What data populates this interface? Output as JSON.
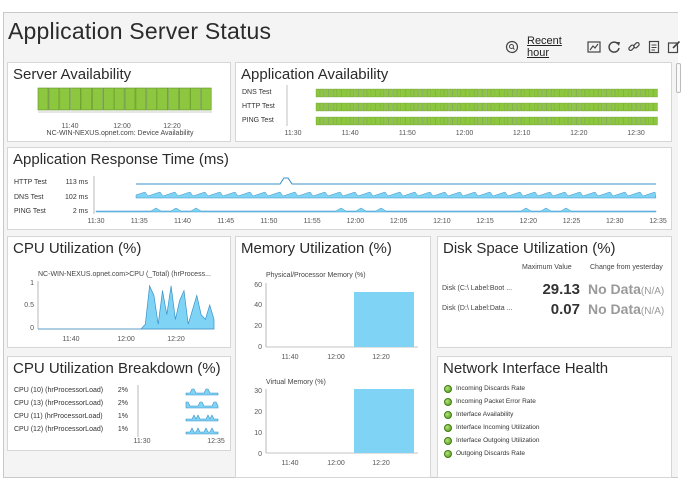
{
  "page": {
    "title": "Application Server Status"
  },
  "toolbar": {
    "range_label": "Recent hour",
    "icons": [
      "search-icon",
      "chart-icon",
      "refresh-icon",
      "link-icon",
      "report-icon",
      "edit-icon"
    ]
  },
  "server_availability": {
    "title": "Server Availability",
    "ticks": [
      "11:40",
      "12:00",
      "12:20"
    ],
    "caption": "NC-WIN-NEXUS.opnet.com: Device Availability",
    "color": "#8dc63f"
  },
  "application_availability": {
    "title": "Application Availability",
    "rows": [
      "DNS Test",
      "HTTP Test",
      "PING Test"
    ],
    "ticks": [
      "11:30",
      "11:40",
      "11:50",
      "12:00",
      "12:10",
      "12:20",
      "12:30"
    ]
  },
  "response_time": {
    "title": "Application Response Time (ms)",
    "rows": [
      {
        "label": "HTTP Test",
        "value": "113 ms"
      },
      {
        "label": "DNS Test",
        "value": "102 ms"
      },
      {
        "label": "PING Test",
        "value": "2 ms"
      }
    ],
    "ticks": [
      "11:30",
      "11:35",
      "11:40",
      "11:45",
      "11:50",
      "11:55",
      "12:00",
      "12:05",
      "12:10",
      "12:15",
      "12:20",
      "12:25",
      "12:30",
      "12:35"
    ]
  },
  "cpu": {
    "title": "CPU Utilization (%)",
    "chart_title": "NC-WIN-NEXUS.opnet.com>CPU (_Total) (hrProcess...",
    "y_ticks": [
      "1",
      "0.5",
      "0"
    ],
    "x_ticks": [
      "11:40",
      "12:00",
      "12:20"
    ]
  },
  "cpu_breakdown": {
    "title": "CPU Utilization Breakdown (%)",
    "rows": [
      {
        "label": "CPU (10) (hrProcessorLoad)",
        "value": "2%"
      },
      {
        "label": "CPU (13) (hrProcessorLoad)",
        "value": "2%"
      },
      {
        "label": "CPU (11) (hrProcessorLoad)",
        "value": "1%"
      },
      {
        "label": "CPU (12) (hrProcessorLoad)",
        "value": "1%"
      }
    ],
    "x_ticks": [
      "11:30",
      "12:35"
    ]
  },
  "memory": {
    "title": "Memory Utilization (%)",
    "chart1_title": "Physical/Processor Memory (%)",
    "chart1_y": [
      "60",
      "40",
      "20",
      "0"
    ],
    "chart2_title": "Virtual Memory (%)",
    "chart2_y": [
      "30",
      "20",
      "10",
      "0"
    ],
    "x_ticks": [
      "11:40",
      "12:00",
      "12:20"
    ],
    "bar_color": "#7fd3f4"
  },
  "disk": {
    "title": "Disk Space Utilization (%)",
    "col_max": "Maximum Value",
    "col_change": "Change from yesterday",
    "rows": [
      {
        "label": "Disk (C:\\ Label:Boot ...",
        "value": "29.13",
        "change": "No Data",
        "change_suffix": "(N/A)"
      },
      {
        "label": "Disk (D:\\ Label:Data ...",
        "value": "0.07",
        "change": "No Data",
        "change_suffix": "(N/A)"
      }
    ]
  },
  "network": {
    "title": "Network Interface Health",
    "items": [
      "Incoming Discards Rate",
      "Incoming Packet Error Rate",
      "Interface Availability",
      "Interface Incoming Utilization",
      "Interface Outgoing Utilization",
      "Outgoing Discards Rate"
    ]
  },
  "colors": {
    "green": "#8dc63f",
    "blue": "#4aa3e0",
    "light_blue": "#7fd3f4"
  }
}
